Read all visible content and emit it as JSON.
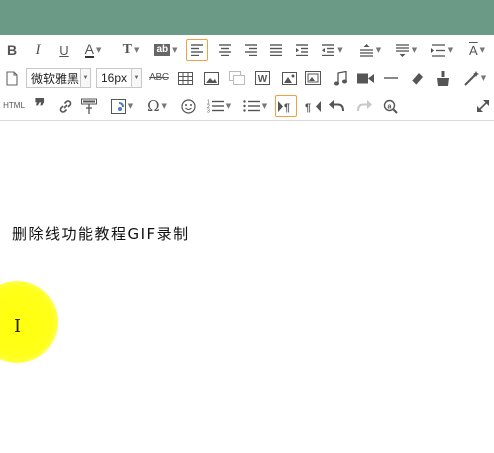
{
  "toolbar": {
    "font_family_value": "微软雅黑",
    "font_size_value": "16px",
    "html_label": "HTML",
    "omega_label": "Ω",
    "abc_label": "ABC",
    "list_label": "1≡",
    "bold_label": "B",
    "italic_label": "I",
    "underline_label": "U",
    "fontcolor_label": "A",
    "textbg_label": "T",
    "ab_label": "ab",
    "textcase_label": "A"
  },
  "icons": [
    "bold-icon",
    "italic-icon",
    "underline-icon",
    "font-color-icon",
    "text-background-icon",
    "ab-highlight-icon",
    "align-left-icon",
    "align-center-icon",
    "align-right-icon",
    "justify-icon",
    "indent-icon",
    "outdent-icon",
    "line-height-icon",
    "paragraph-spacing-icon",
    "letter-spacing-icon",
    "text-case-icon",
    "clear-format-icon",
    "new-document-icon",
    "strikethrough-icon",
    "table-icon",
    "image-icon",
    "gallery-icon",
    "word-icon",
    "picture-icon",
    "insert-image-icon",
    "music-icon",
    "video-icon",
    "horizontal-rule-icon",
    "eraser-icon",
    "brush-icon",
    "magic-wand-icon",
    "html-source-icon",
    "quote-icon",
    "link-icon",
    "format-painter-icon",
    "border-icon",
    "omega-icon",
    "emoji-icon",
    "ordered-list-icon",
    "unordered-list-icon",
    "ltr-icon",
    "rtl-icon",
    "undo-icon",
    "redo-icon",
    "search-replace-icon",
    "fullscreen-icon"
  ],
  "editor": {
    "paragraph": "删除线功能教程GIF录制"
  },
  "colors": {
    "titlebar": "#6b9a86",
    "selected_border": "#f0a040",
    "cursor_highlight": "#ffff00"
  }
}
